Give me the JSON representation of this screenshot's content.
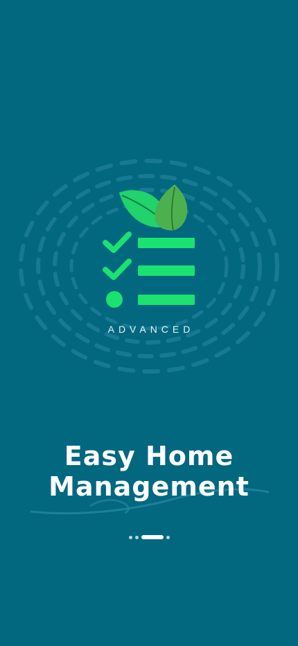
{
  "onboarding": {
    "brand_text": "ADVANCED",
    "title_line1": "Easy Home",
    "title_line2": "Management",
    "pager": {
      "total_pages": 4,
      "active_index": 2
    }
  },
  "icons": {
    "logo": "checklist-leaf-icon"
  },
  "colors": {
    "background": "#016880",
    "accent_green": "#1be26f",
    "leaf_light": "#21d46b",
    "leaf_dark": "#4caf50",
    "text": "#ffffff"
  }
}
